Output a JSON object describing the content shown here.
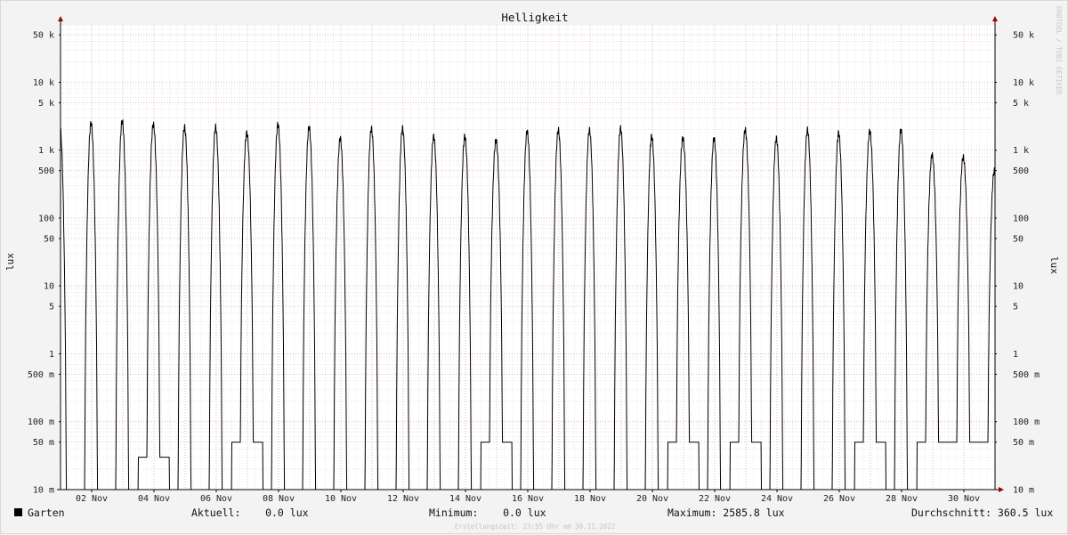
{
  "chart_data": {
    "type": "line",
    "title": "Helligkeit",
    "ylabel": "lux",
    "yscale": "log",
    "ylim": [
      0.01,
      70000
    ],
    "xlim": [
      0,
      30
    ],
    "y_ticks": [
      {
        "value": 50000,
        "label": "50 k"
      },
      {
        "value": 10000,
        "label": "10 k"
      },
      {
        "value": 5000,
        "label": "5 k"
      },
      {
        "value": 1000,
        "label": "1 k"
      },
      {
        "value": 500,
        "label": "500"
      },
      {
        "value": 100,
        "label": "100"
      },
      {
        "value": 50,
        "label": "50"
      },
      {
        "value": 10,
        "label": "10"
      },
      {
        "value": 5,
        "label": "5"
      },
      {
        "value": 1,
        "label": "1"
      },
      {
        "value": 0.5,
        "label": "500 m"
      },
      {
        "value": 0.1,
        "label": "100 m"
      },
      {
        "value": 0.05,
        "label": "50 m"
      },
      {
        "value": 0.01,
        "label": "10 m"
      }
    ],
    "x_ticks": [
      {
        "value": 1,
        "label": "02 Nov"
      },
      {
        "value": 3,
        "label": "04 Nov"
      },
      {
        "value": 5,
        "label": "06 Nov"
      },
      {
        "value": 7,
        "label": "08 Nov"
      },
      {
        "value": 9,
        "label": "10 Nov"
      },
      {
        "value": 11,
        "label": "12 Nov"
      },
      {
        "value": 13,
        "label": "14 Nov"
      },
      {
        "value": 15,
        "label": "16 Nov"
      },
      {
        "value": 17,
        "label": "18 Nov"
      },
      {
        "value": 19,
        "label": "20 Nov"
      },
      {
        "value": 21,
        "label": "22 Nov"
      },
      {
        "value": 23,
        "label": "24 Nov"
      },
      {
        "value": 25,
        "label": "26 Nov"
      },
      {
        "value": 27,
        "label": "28 Nov"
      },
      {
        "value": 29,
        "label": "30 Nov"
      }
    ],
    "series": [
      {
        "name": "Garten",
        "color": "#000000",
        "daily_peaks": [
          2200,
          2500,
          2700,
          2400,
          2200,
          2200,
          1800,
          2400,
          2200,
          1500,
          2100,
          2100,
          1600,
          1600,
          1400,
          1900,
          2000,
          2000,
          2100,
          1600,
          1500,
          1500,
          2000,
          1500,
          2000,
          1800,
          1900,
          2000,
          850,
          800,
          500
        ],
        "night_levels": [
          0.01,
          0.01,
          0.01,
          0.03,
          0.01,
          0.01,
          0.05,
          0.01,
          0.01,
          0.01,
          0.01,
          0.01,
          0.01,
          0.01,
          0.05,
          0.01,
          0.01,
          0.01,
          0.01,
          0.01,
          0.05,
          0.01,
          0.05,
          0.01,
          0.01,
          0.01,
          0.05,
          0.01,
          0.05,
          0.05,
          0.05
        ]
      }
    ],
    "grid": true,
    "legend": "bottom-left"
  },
  "legend": {
    "name": "Garten"
  },
  "stats": {
    "current": "Aktuell:    0.0 lux",
    "minimum": "Minimum:    0.0 lux",
    "maximum": "Maximum: 2585.8 lux",
    "average": "Durchschnitt: 360.5 lux"
  },
  "footer": "Erstellungszeit: 23:55 Uhr am 30.11.2022",
  "watermark": "RRDTOOL / TOBI OETIKER",
  "colors": {
    "background": "#f3f3f3",
    "plot": "#ffffff",
    "grid_major": "#e7a3a3",
    "grid_minor": "#d6d6d6",
    "axis": "#000000",
    "arrow": "#a00000"
  }
}
